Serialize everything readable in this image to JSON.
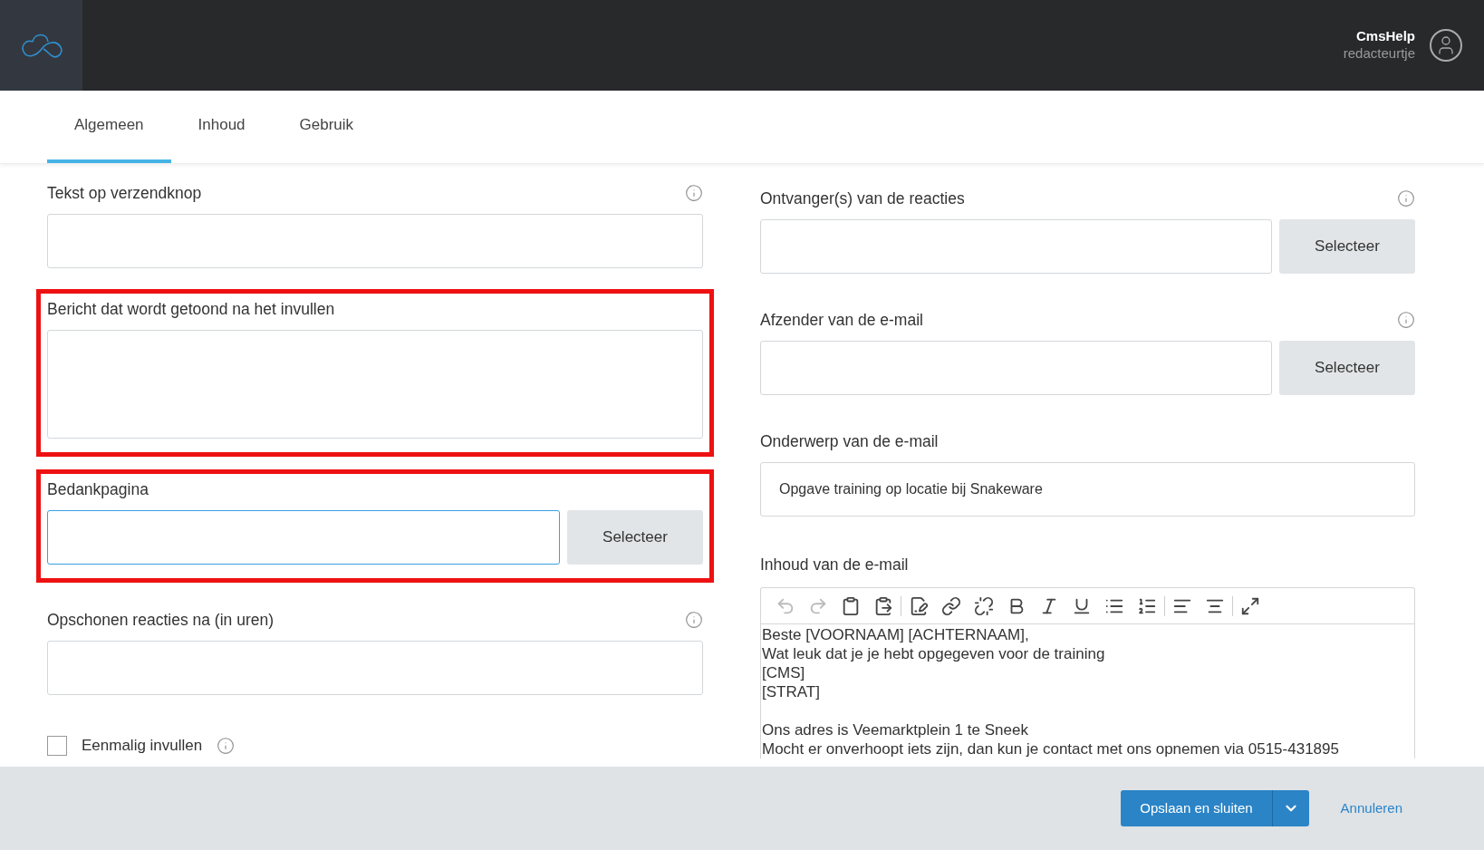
{
  "header": {
    "user_name": "CmsHelp",
    "user_role": "redacteurtje"
  },
  "tabs": [
    {
      "label": "Algemeen",
      "selected": true
    },
    {
      "label": "Inhoud",
      "selected": false
    },
    {
      "label": "Gebruik",
      "selected": false
    }
  ],
  "left_fields": [
    {
      "kind": "text",
      "label": "Tekst op verzendknop",
      "info": true,
      "highlighted": false,
      "focused": false
    },
    {
      "kind": "textarea",
      "label": "Bericht dat wordt getoond na het invullen",
      "info": false,
      "highlighted": true,
      "focused": false
    },
    {
      "kind": "select",
      "label": "Bedankpagina",
      "button": "Selecteer",
      "info": false,
      "highlighted": true,
      "focused": true
    },
    {
      "kind": "text",
      "label": "Opschonen reacties na (in uren)",
      "info": true,
      "highlighted": false,
      "focused": false
    }
  ],
  "checkbox": {
    "label": "Eenmalig invullen",
    "checked": false,
    "info": true
  },
  "right_fields": [
    {
      "kind": "select",
      "label": "Ontvanger(s) van de reacties",
      "button": "Selecteer",
      "info": true
    },
    {
      "kind": "select",
      "label": "Afzender van de e-mail",
      "button": "Selecteer",
      "info": true
    },
    {
      "kind": "text",
      "label": "Onderwerp van de e-mail",
      "value": "Opgave training op locatie bij Snakeware",
      "info": false
    }
  ],
  "editor": {
    "label": "Inhoud van de e-mail",
    "paragraphs": [
      [
        "Beste [VOORNAAM] [ACHTERNAAM],",
        "Wat leuk dat je je hebt opgegeven voor de training",
        "[CMS]",
        "[STRAT]"
      ],
      [
        "Ons adres is Veemarktplein 1 te Sneek",
        "Mocht er onverhoopt iets zijn, dan kun je contact met ons opnemen via 0515-431895"
      ]
    ]
  },
  "footer": {
    "save_button": "Opslaan en sluiten",
    "cancel_link": "Annuleren"
  }
}
